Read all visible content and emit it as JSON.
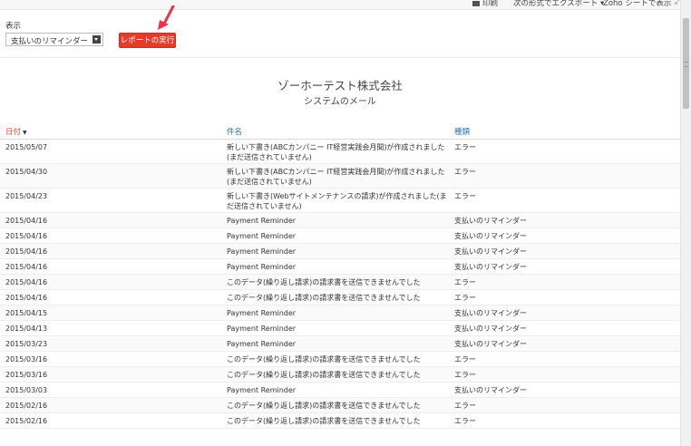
{
  "toolbar": {
    "print_label": "印刷",
    "export_label": "次の形式でエクスポート",
    "export_caret": "▾",
    "zoho_sheet_label": "Zoho シートで表示",
    "expand_icon": "expand-icon"
  },
  "filter": {
    "show_label": "表示",
    "selected_value": "支払いのリマインダー",
    "run_button_label": "レポートの実行"
  },
  "report": {
    "company": "ゾーホーテスト株式会社",
    "subtitle": "システムのメール",
    "columns": {
      "date": "日付",
      "subject": "件名",
      "type": "種類"
    },
    "sort_indicator": "▼",
    "rows": [
      {
        "date": "2015/05/07",
        "subject": "新しい下書き(ABCカンパニー IT経営実践会月間)が作成されました(まだ送信されていません)",
        "type": "エラー"
      },
      {
        "date": "2015/04/30",
        "subject": "新しい下書き(ABCカンパニー IT経営実践会月間)が作成されました(まだ送信されていません)",
        "type": "エラー"
      },
      {
        "date": "2015/04/23",
        "subject": "新しい下書き(Webサイトメンテナンスの請求)が作成されました(まだ送信されていません)",
        "type": "エラー"
      },
      {
        "date": "2015/04/16",
        "subject": "Payment Reminder",
        "type": "支払いのリマインダー"
      },
      {
        "date": "2015/04/16",
        "subject": "Payment Reminder",
        "type": "支払いのリマインダー"
      },
      {
        "date": "2015/04/16",
        "subject": "Payment Reminder",
        "type": "支払いのリマインダー"
      },
      {
        "date": "2015/04/16",
        "subject": "Payment Reminder",
        "type": "支払いのリマインダー"
      },
      {
        "date": "2015/04/16",
        "subject": "このデータ(繰り返し請求)の請求書を送信できませんでした",
        "type": "エラー"
      },
      {
        "date": "2015/04/16",
        "subject": "このデータ(繰り返し請求)の請求書を送信できませんでした",
        "type": "エラー"
      },
      {
        "date": "2015/04/15",
        "subject": "Payment Reminder",
        "type": "支払いのリマインダー"
      },
      {
        "date": "2015/04/13",
        "subject": "Payment Reminder",
        "type": "支払いのリマインダー"
      },
      {
        "date": "2015/03/23",
        "subject": "Payment Reminder",
        "type": "支払いのリマインダー"
      },
      {
        "date": "2015/03/16",
        "subject": "このデータ(繰り返し請求)の請求書を送信できませんでした",
        "type": "エラー"
      },
      {
        "date": "2015/03/16",
        "subject": "このデータ(繰り返し請求)の請求書を送信できませんでした",
        "type": "エラー"
      },
      {
        "date": "2015/03/03",
        "subject": "Payment Reminder",
        "type": "支払いのリマインダー"
      },
      {
        "date": "2015/02/16",
        "subject": "このデータ(繰り返し請求)の請求書を送信できませんでした",
        "type": "エラー"
      },
      {
        "date": "2015/02/16",
        "subject": "このデータ(繰り返し請求)の請求書を送信できませんでした",
        "type": "エラー"
      }
    ]
  },
  "colors": {
    "accent_red": "#e53b28",
    "link_blue": "#2a6fb6",
    "annotation_arrow": "#e8344a"
  }
}
